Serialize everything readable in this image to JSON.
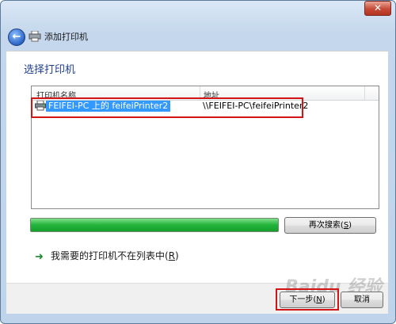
{
  "window": {
    "close_label": "✕"
  },
  "header": {
    "title": "添加打印机",
    "back_icon": "back-arrow-icon"
  },
  "page": {
    "title": "选择打印机"
  },
  "list": {
    "columns": [
      "打印机名称",
      "地址"
    ],
    "rows": [
      {
        "name": "FEIFEI-PC 上的 feifeiPrinter2",
        "address": "\\\\FEIFEI-PC\\feifeiPrinter2",
        "selected": true
      }
    ]
  },
  "progress": {
    "fraction": 1.0,
    "color": "#22b33a"
  },
  "search_again": {
    "label": "再次搜索(",
    "key": "S",
    "suffix": ")"
  },
  "not_listed_link": {
    "label": "我需要的打印机不在列表中(",
    "key": "R",
    "suffix": ")"
  },
  "footer": {
    "next": {
      "label": "下一步(",
      "key": "N",
      "suffix": ")"
    },
    "cancel": {
      "label": "取消"
    }
  },
  "watermark": "Baidu 经验",
  "colors": {
    "selection": "#3399ff",
    "annotation": "#d31515",
    "title": "#1e3e8e"
  }
}
